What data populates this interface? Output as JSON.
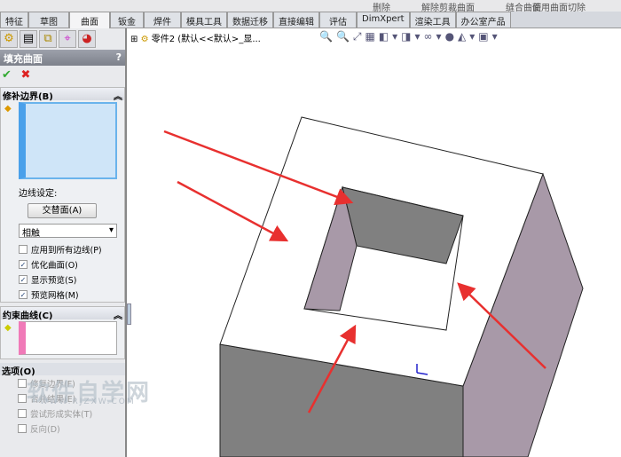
{
  "ribbon": {
    "items": [
      "缝合曲面",
      "删除",
      "解除剪裁曲面",
      "使用曲面切除"
    ]
  },
  "tabs": [
    "特征",
    "草图",
    "曲面",
    "钣金",
    "焊件",
    "模具工具",
    "数据迁移",
    "直接编辑",
    "评估",
    "DimXpert",
    "渲染工具",
    "办公室产品"
  ],
  "active_tab": "曲面",
  "panel": {
    "title": "填充曲面",
    "help": "?",
    "ok": "✔",
    "cancel": "✖",
    "boundary": {
      "title": "修补边界(B)",
      "edge_label": "边线设定:",
      "alt_face_button": "交替面(A)",
      "contact_select": "相触",
      "options": [
        {
          "label": "应用到所有边线(P)",
          "checked": false
        },
        {
          "label": "优化曲面(O)",
          "checked": true
        },
        {
          "label": "显示预览(S)",
          "checked": true
        },
        {
          "label": "预览网格(M)",
          "checked": true
        }
      ]
    },
    "constraint": {
      "title": "约束曲线(C)"
    },
    "options": {
      "title": "选项(O)",
      "items": [
        {
          "label": "修复边界(F)",
          "checked": false
        },
        {
          "label": "合并结果(E)",
          "checked": false
        },
        {
          "label": "尝试形成实体(T)",
          "checked": false
        },
        {
          "label": "反向(D)",
          "checked": false
        }
      ]
    }
  },
  "view": {
    "tree_item": "零件2  (默认<<默认>_显..."
  },
  "watermark": {
    "text": "软件自学网",
    "url": "WWW.RJZXW.COM"
  },
  "colors": {
    "arrow": "#e8302f",
    "wall_gray": "#808080",
    "wall_purple": "#a899a8"
  }
}
